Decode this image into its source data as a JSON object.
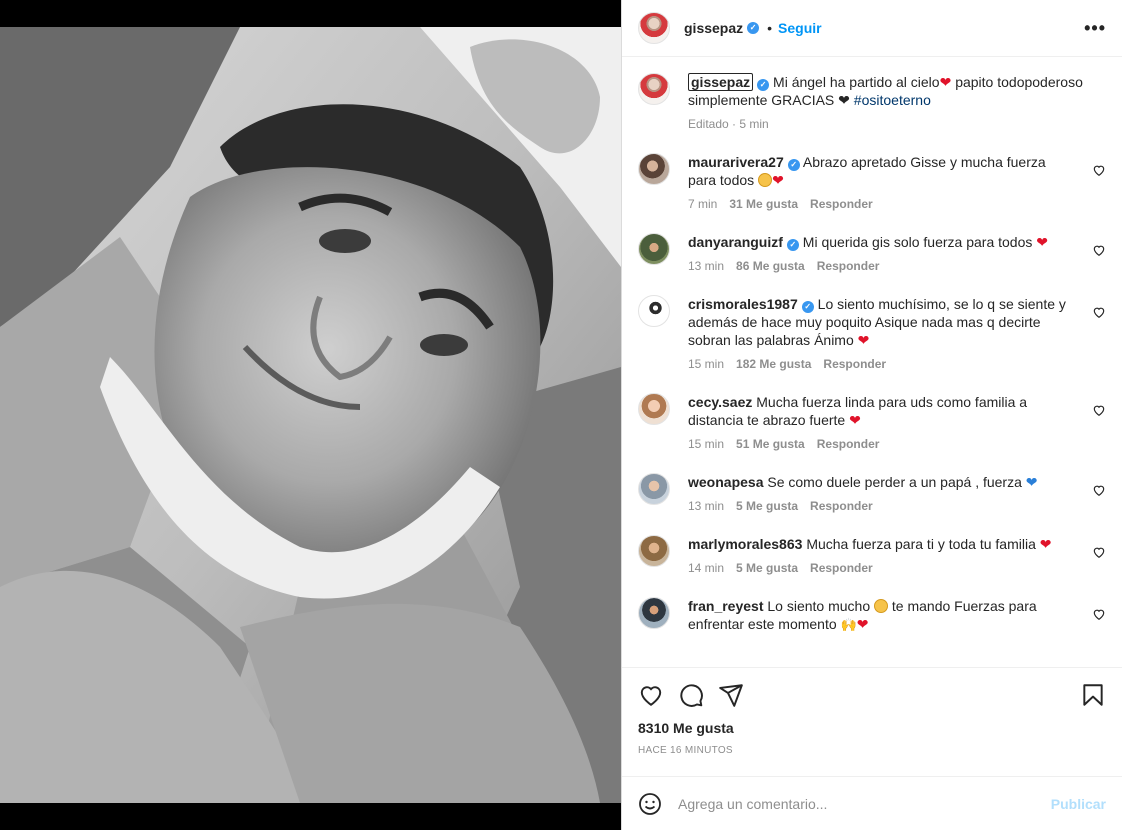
{
  "post": {
    "username": "gissepaz",
    "separator": "•",
    "follow_label": "Seguir",
    "more_label": "•••"
  },
  "caption": {
    "username": "gissepaz",
    "text_a": "Mi ángel ha partido al cielo",
    "text_b": " papito todopoderoso simplemente GRACIAS ",
    "hashtag": "#ositoeterno",
    "edited_label": "Editado",
    "time": "5 min"
  },
  "comments": [
    {
      "username": "maurarivera27",
      "text": "Abrazo apretado Gisse y mucha fuerza para todos",
      "emojis": "face,heart",
      "time": "7 min",
      "likes": "31 Me gusta",
      "reply": "Responder",
      "verified": true
    },
    {
      "username": "danyaranguizf",
      "text": "Mi querida gis solo fuerza para todos",
      "emojis": "heart",
      "time": "13 min",
      "likes": "86 Me gusta",
      "reply": "Responder",
      "verified": true
    },
    {
      "username": "crismorales1987",
      "text": "Lo siento muchísimo, se lo q se siente y además de hace muy poquito Asique nada mas q decirte sobran las palabras Ánimo",
      "emojis": "heart",
      "time": "15 min",
      "likes": "182 Me gusta",
      "reply": "Responder",
      "verified": true
    },
    {
      "username": "cecy.saez",
      "text": "Mucha fuerza linda para uds como familia a distancia te abrazo fuerte",
      "emojis": "heart",
      "time": "15 min",
      "likes": "51 Me gusta",
      "reply": "Responder",
      "verified": false
    },
    {
      "username": "weonapesa",
      "text": "Se como duele perder a un papá , fuerza",
      "emojis": "blue",
      "time": "13 min",
      "likes": "5 Me gusta",
      "reply": "Responder",
      "verified": false
    },
    {
      "username": "marlymorales863",
      "text": "Mucha fuerza para ti y toda tu familia",
      "emojis": "heart",
      "time": "14 min",
      "likes": "5 Me gusta",
      "reply": "Responder",
      "verified": false
    },
    {
      "username": "fran_reyest",
      "text_a": "Lo siento mucho",
      "text_b": " te mando Fuerzas para enfrentar este momento",
      "time": "",
      "likes": "",
      "reply": "",
      "verified": false
    }
  ],
  "stats": {
    "likes": "8310 Me gusta",
    "time_ago": "HACE 16 MINUTOS"
  },
  "add_comment": {
    "placeholder": "Agrega un comentario...",
    "publish_label": "Publicar"
  },
  "icons": [
    "like-icon",
    "comment-icon",
    "share-icon",
    "save-icon",
    "emoji-icon",
    "more-icon",
    "verified-icon"
  ],
  "colors": {
    "accent": "#0095f6",
    "verified": "#3897f0",
    "heart": "#e0132a",
    "publish_disabled": "#b2dffc"
  }
}
